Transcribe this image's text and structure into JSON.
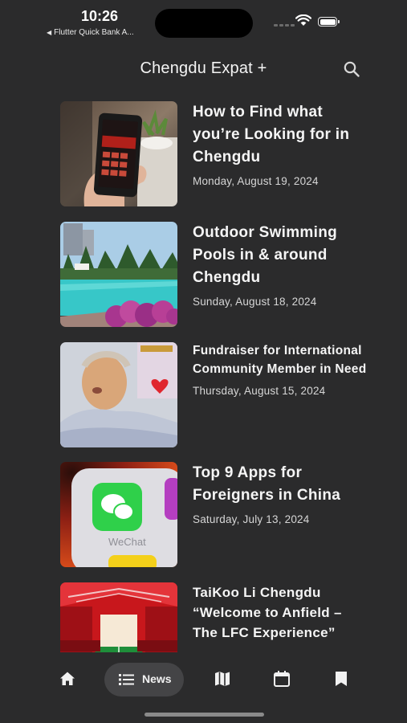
{
  "status_bar": {
    "time": "10:26",
    "back_app": "Flutter Quick Bank A..."
  },
  "header": {
    "title": "Chengdu Expat +",
    "search_icon": "search-icon"
  },
  "articles": [
    {
      "title": "How to Find what you’re Looking for in Chengdu",
      "date": "Monday, August 19, 2024"
    },
    {
      "title": "Outdoor Swimming Pools in & around Chengdu",
      "date": "Sunday, August 18, 2024"
    },
    {
      "title": "Fundraiser for International Community Member in Need",
      "date": "Thursday, August 15, 2024"
    },
    {
      "title": "Top 9 Apps for Foreigners in China",
      "date": "Saturday, July 13, 2024"
    },
    {
      "title": "TaiKoo Li Chengdu “Welcome to Anfield – The LFC Experience”",
      "date": ""
    }
  ],
  "thumbnail_text": {
    "wechat": "WeChat"
  },
  "bottom_nav": {
    "items": [
      {
        "icon": "home-icon"
      },
      {
        "icon": "list-icon",
        "label": "News",
        "selected": true
      },
      {
        "icon": "map-icon"
      },
      {
        "icon": "calendar-icon"
      },
      {
        "icon": "bookmark-icon"
      }
    ]
  },
  "colors": {
    "background": "#2b2b2c",
    "nav_pill": "#444446",
    "text": "#f5f5f5"
  }
}
